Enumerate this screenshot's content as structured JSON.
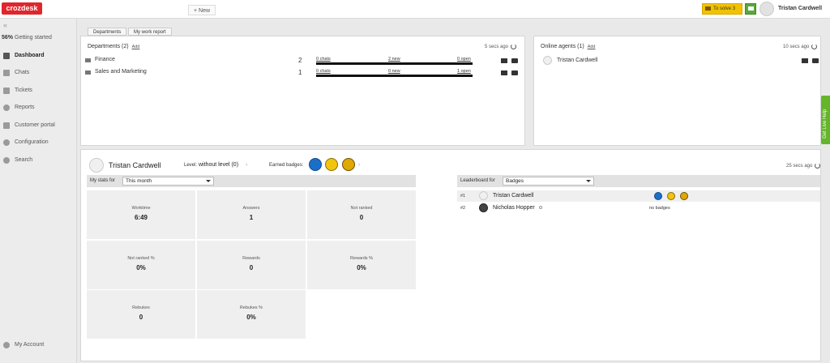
{
  "app": {
    "logo": "crozdesk"
  },
  "topbar": {
    "new_label": "+ New",
    "to_solve_label": "To solve",
    "to_solve_count": "3",
    "user_name": "Tristan Cardwell"
  },
  "sidebar": {
    "collapse": "«",
    "getting_started_pct": "56%",
    "items": [
      {
        "label": "Getting started"
      },
      {
        "label": "Dashboard"
      },
      {
        "label": "Chats"
      },
      {
        "label": "Tickets"
      },
      {
        "label": "Reports"
      },
      {
        "label": "Customer portal"
      },
      {
        "label": "Configuration"
      },
      {
        "label": "Search"
      }
    ],
    "account_label": "My Account"
  },
  "tabs": [
    {
      "label": "Departments"
    },
    {
      "label": "My work report"
    }
  ],
  "departments": {
    "title": "Departments (2)",
    "add": "Add",
    "updated": "5 secs ago",
    "rows": [
      {
        "name": "Finance",
        "count": "2",
        "chats": "0 chats",
        "new": "2 new",
        "open": "0 open"
      },
      {
        "name": "Sales and Marketing",
        "count": "1",
        "chats": "0 chats",
        "new": "0 new",
        "open": "1 open"
      }
    ]
  },
  "agents": {
    "title": "Online agents (1)",
    "add": "Add",
    "updated": "10 secs ago",
    "rows": [
      {
        "name": "Tristan Cardwell"
      }
    ]
  },
  "stats": {
    "user_name": "Tristan Cardwell",
    "level_label": "Level:",
    "level_value": "without level (0)",
    "badges_label": "Earned badges:",
    "updated": "25 secs ago",
    "my_stats_for": "My stats for",
    "period": "This month",
    "leaderboard_for": "Leaderboard for",
    "leaderboard_select": "Badges",
    "cells": [
      {
        "label": "Worktime",
        "value": "6:49"
      },
      {
        "label": "Answers",
        "value": "1"
      },
      {
        "label": "Not ranked",
        "value": "0"
      },
      {
        "label": "Not ranked %",
        "value": "0%"
      },
      {
        "label": "Rewards",
        "value": "0"
      },
      {
        "label": "Rewards %",
        "value": "0%"
      },
      {
        "label": "Rebukes",
        "value": "0"
      },
      {
        "label": "Rebukes %",
        "value": "0%"
      }
    ],
    "leaderboard": [
      {
        "rank": "#1",
        "name": "Tristan Cardwell",
        "badges": ""
      },
      {
        "rank": "#2",
        "name": "Nicholas Hopper",
        "badges": "no badges"
      }
    ]
  },
  "help_tab": "Get Live Help",
  "colors": {
    "brand": "#e0262c",
    "to_solve": "#f2c200",
    "help": "#64b52a"
  }
}
